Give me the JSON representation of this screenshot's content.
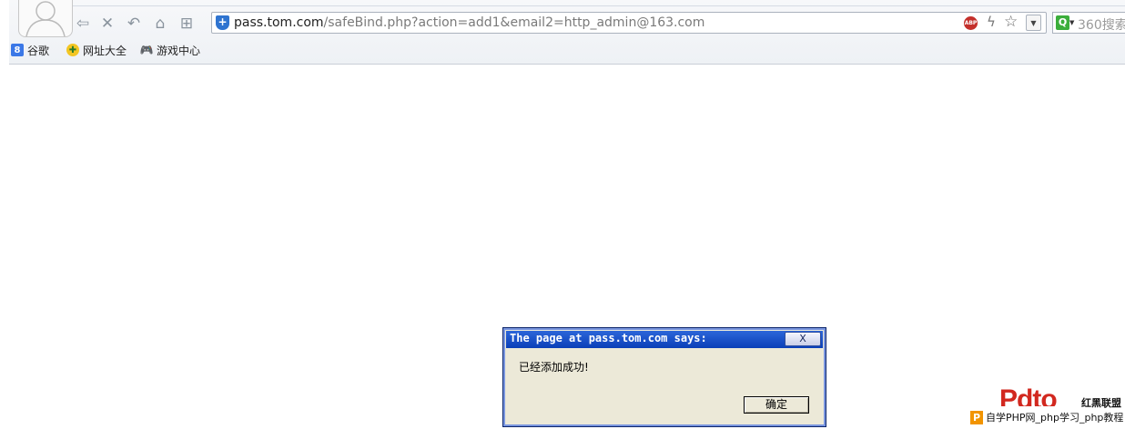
{
  "browser": {
    "address_bar": {
      "domain": "pass.tom.com",
      "path": "/safeBind.php?action=add1&email2=http_admin@163.com"
    },
    "search_box": {
      "placeholder": "360搜索"
    },
    "toolbar_icons": [
      "back-icon",
      "stop-icon",
      "undo-icon",
      "home-icon",
      "grid-icon",
      "adblock-icon",
      "lightning-icon",
      "favorite-star-icon",
      "dropdown-icon"
    ],
    "bookmarks": [
      {
        "label": "谷歌",
        "icon": "google-icon",
        "color": "#3b78e7"
      },
      {
        "label": "网址大全",
        "icon": "site-nav-icon",
        "color": "#f3c623"
      },
      {
        "label": "游戏中心",
        "icon": "gamepad-icon",
        "color": "#888888"
      }
    ]
  },
  "dialog": {
    "title": "The page at pass.tom.com says:",
    "close_label": "X",
    "message": "已经添加成功!",
    "ok_label": "确定"
  },
  "watermark": {
    "logo_text": "Pdto",
    "tag": "红黑联盟",
    "p_icon": "P",
    "text": "自学PHP网_php学习_php教程"
  }
}
